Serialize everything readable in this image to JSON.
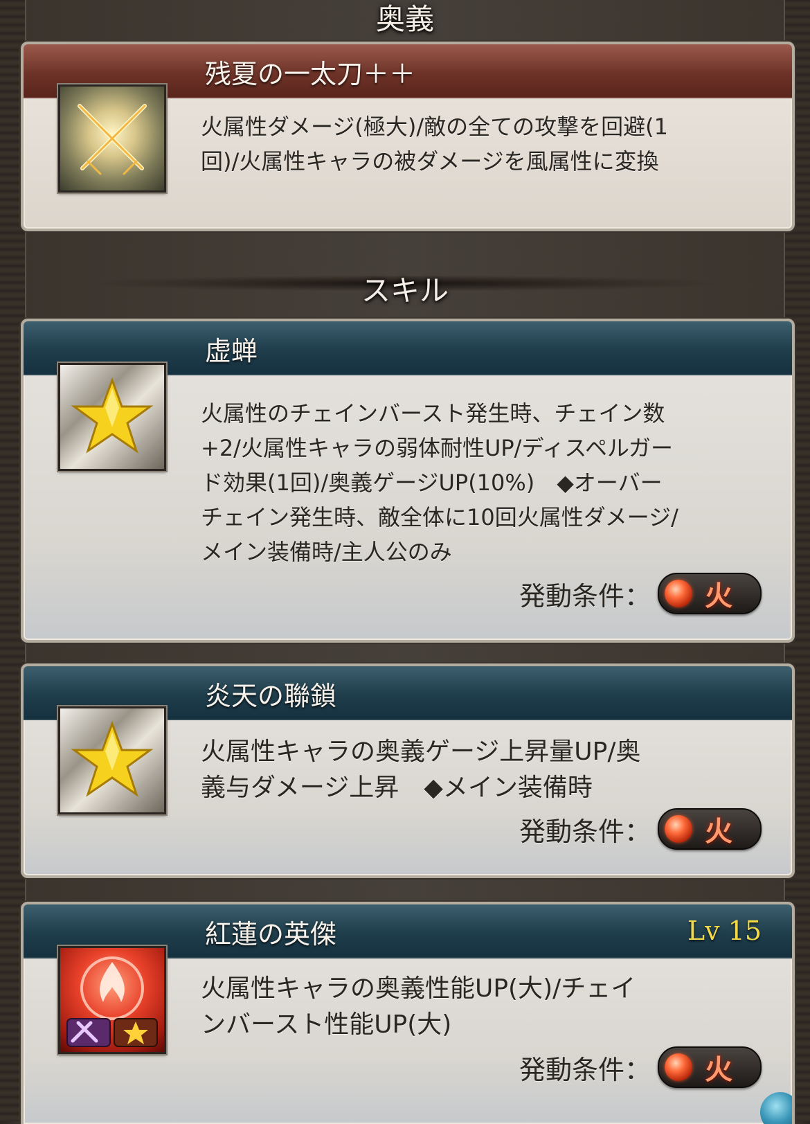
{
  "sections": {
    "ougi_heading": "奥義",
    "skill_heading": "スキル"
  },
  "ougi": {
    "title": "残夏の一太刀＋＋",
    "icon": "crossed-swords-icon",
    "description_lines": [
      "火属性ダメージ(極大)/敵の全ての攻撃を回避(1",
      "回)/火属性キャラの被ダメージを風属性に変換"
    ]
  },
  "skills": [
    {
      "title": "虚蝉",
      "icon": "star-icon",
      "description_lines": [
        "火属性のチェインバースト発生時、チェイン数",
        "+2/火属性キャラの弱体耐性UP/ディスペルガー",
        "ド効果(1回)/奥義ゲージUP(10%)　◆オーバー",
        "チェイン発生時、敵全体に10回火属性ダメージ/",
        "メイン装備時/主人公のみ"
      ],
      "condition_label": "発動条件：",
      "element": "火"
    },
    {
      "title": "炎天の聯鎖",
      "icon": "star-icon",
      "description_lines": [
        "火属性キャラの奥義ゲージ上昇量UP/奥",
        "義与ダメージ上昇　◆メイン装備時"
      ],
      "condition_label": "発動条件：",
      "element": "火"
    },
    {
      "title": "紅蓮の英傑",
      "level": "Lv 15",
      "icon": "fire-might-icon",
      "description_lines": [
        "火属性キャラの奥義性能UP(大)/チェイ",
        "ンバースト性能UP(大)"
      ],
      "condition_label": "発動条件：",
      "element": "火"
    }
  ],
  "colors": {
    "ougi_header": "#6e3328",
    "skill_header": "#1f3d4b",
    "level_text": "#f2d94a",
    "fire": "#ff6b3a"
  }
}
